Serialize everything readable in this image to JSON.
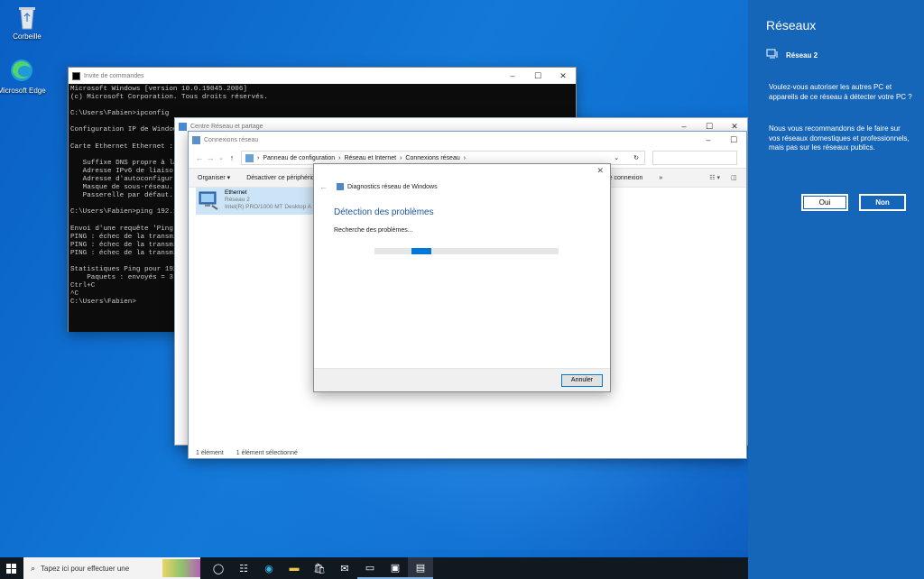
{
  "desktop": {
    "icons": [
      {
        "label": "Corbeille"
      },
      {
        "label": "Microsoft Edge"
      }
    ]
  },
  "cmd_window": {
    "title": "Invite de commandes",
    "lines": [
      "Microsoft Windows [version 10.0.19045.2006]",
      "(c) Microsoft Corporation. Tous droits réservés.",
      "",
      "C:\\Users\\Fabien>ipconfig",
      "",
      "Configuration IP de Window",
      "",
      "Carte Ethernet Ethernet :",
      "",
      "   Suffixe DNS propre à la",
      "   Adresse IPv6 de liaiso",
      "   Adresse d'autoconfigur",
      "   Masque de sous-réseau.",
      "   Passerelle par défaut.",
      "",
      "C:\\Users\\Fabien>ping 192.1",
      "",
      "Envoi d'une requête 'Ping'",
      "PING : échec de la transmi",
      "PING : échec de la transmi",
      "PING : échec de la transmi",
      "",
      "Statistiques Ping pour 192",
      "    Paquets : envoyés = 3,",
      "Ctrl+C",
      "^C",
      "C:\\Users\\Fabien>"
    ]
  },
  "sharing_center": {
    "title": "Centre Réseau et partage"
  },
  "connections_window": {
    "title": "Connexions réseau",
    "breadcrumb": [
      "Panneau de configuration",
      "Réseau et Internet",
      "Connexions réseau"
    ],
    "toolbar": {
      "organize": "Organiser",
      "disable": "Désactiver ce périphériq",
      "rename": "te connexion",
      "more": "»"
    },
    "adapter": {
      "name": "Ethernet",
      "network": "Réseau 2",
      "device": "Intel(R) PRO/1000 MT Desktop A"
    },
    "status": {
      "count": "1 élément",
      "selected": "1 élément sélectionné"
    }
  },
  "diagnostics_dialog": {
    "title": "Diagnostics réseau de Windows",
    "heading": "Détection des problèmes",
    "message": "Recherche des problèmes...",
    "progress": 0.2,
    "cancel_label": "Annuler"
  },
  "network_flyout": {
    "title": "Réseaux",
    "network_name": "Réseau 2",
    "question": "Voulez-vous autoriser les autres PC et appareils de ce réseau à détecter votre PC ?",
    "recommendation": "Nous vous recommandons de le faire sur vos réseaux domestiques et professionnels, mais pas sur les réseaux publics.",
    "yes_label": "Oui",
    "no_label": "Non"
  },
  "taskbar": {
    "search_placeholder": "Tapez ici pour effectuer une"
  },
  "colors": {
    "accent": "#1565b8",
    "link_heading": "#1e56a0",
    "progress": "#0078d7"
  }
}
